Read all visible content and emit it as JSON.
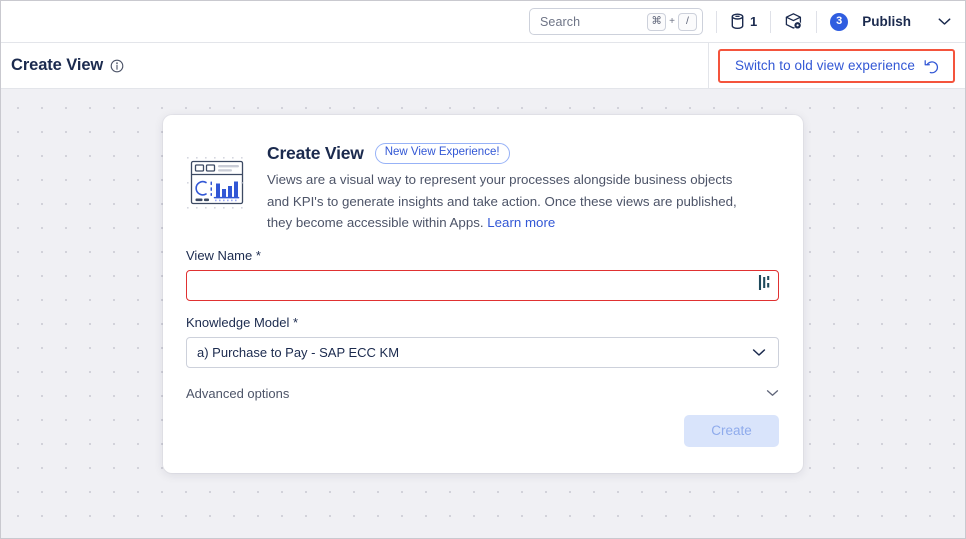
{
  "topbar": {
    "search": {
      "placeholder": "Search",
      "kbd_mod": "⌘",
      "kbd_plus": "+",
      "kbd_key": "/"
    },
    "data_pool": {
      "icon": "database-icon",
      "count": "1"
    },
    "package": {
      "icon": "package-settings-icon"
    },
    "publish": {
      "count": "3",
      "label": "Publish",
      "caret": "chevron-down-icon"
    }
  },
  "pageheader": {
    "title": "Create View",
    "info_icon": "info-icon",
    "switch_button": {
      "label": "Switch to old view experience",
      "icon": "undo-arrow-icon",
      "highlight_color": "#f4543c",
      "text_color": "#3257d5"
    }
  },
  "card": {
    "illustration": "dashboard-chart-icon",
    "title": "Create View",
    "pill": "New View Experience!",
    "description": "Views are a visual way to represent your processes alongside business objects and KPI's to generate insights and take action. Once these views are published, they become accessible within Apps.",
    "learn_more": "Learn more",
    "view_name": {
      "label": "View Name *",
      "value": "",
      "placeholder": "",
      "error_border_color": "#e03131",
      "cursor_icon": "text-cursor-icon"
    },
    "knowledge_model": {
      "label": "Knowledge Model *",
      "value": "a) Purchase to Pay - SAP ECC KM",
      "caret": "chevron-down-icon"
    },
    "advanced_options": {
      "label": "Advanced options",
      "caret": "chevron-down-icon"
    },
    "create_button": {
      "label": "Create",
      "disabled": true
    }
  },
  "colors": {
    "accent_blue": "#3257d5",
    "badge_blue": "#2f5de0",
    "navy": "#1b2a4e",
    "canvas_bg": "#f0f0f4",
    "error_red": "#e03131",
    "highlight_red": "#f4543c"
  }
}
